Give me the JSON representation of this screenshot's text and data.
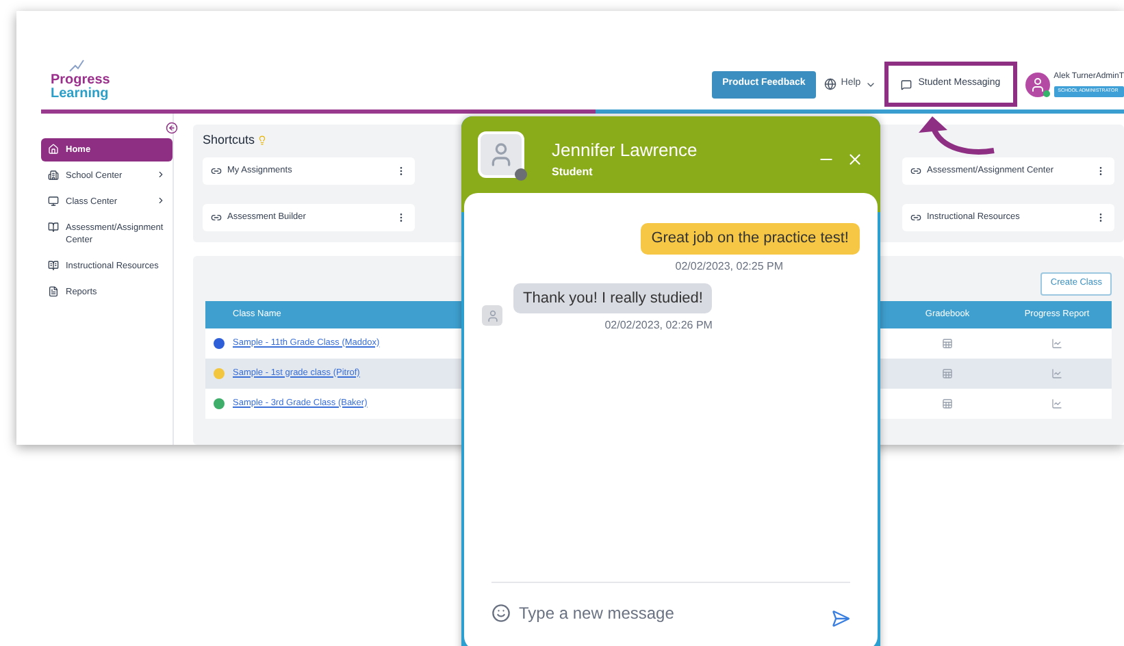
{
  "app": {
    "logo": {
      "line1": "Progress",
      "line2": "Learning"
    },
    "header": {
      "feedback_button": "Product Feedback",
      "help": "Help",
      "messaging": {
        "label": "Student Messaging",
        "highlighted": true
      },
      "user": {
        "name": "Alek TurnerAdminT",
        "role": "SCHOOL ADMINISTRATOR"
      }
    },
    "sidebar": {
      "items": [
        {
          "label": "Home",
          "selected": true,
          "expandable": false
        },
        {
          "label": "School Center",
          "selected": false,
          "expandable": true
        },
        {
          "label": "Class Center",
          "selected": false,
          "expandable": true
        },
        {
          "label": "Assessment/Assignment Center",
          "selected": false,
          "expandable": false
        },
        {
          "label": "Instructional Resources",
          "selected": false,
          "expandable": false
        },
        {
          "label": "Reports",
          "selected": false,
          "expandable": false
        }
      ]
    },
    "shortcuts": {
      "title": "Shortcuts",
      "items": [
        {
          "label": "My Assignments"
        },
        {
          "label": "Assessment/Assignment Center"
        },
        {
          "label": "Assessment Builder"
        },
        {
          "label": "Instructional Resources"
        }
      ]
    },
    "classes": {
      "create_button": "Create Class",
      "columns": [
        "Class Name",
        "Gradebook",
        "Progress Report"
      ],
      "rows": [
        {
          "name": "Sample - 11th Grade Class (Maddox)",
          "color": "#2f5fd8"
        },
        {
          "name": "Sample - 1st grade class (Pitrof)",
          "color": "#f3c640"
        },
        {
          "name": "Sample - 3rd Grade Class (Baker)",
          "color": "#3fae6a"
        }
      ]
    }
  },
  "chat": {
    "name": "Jennifer Lawrence",
    "role": "Student",
    "messages": [
      {
        "kind": "sent",
        "text": "Great job on the practice test!",
        "time": "02/02/2023, 02:25 PM"
      },
      {
        "kind": "received",
        "text": "Thank you! I really studied!",
        "time": "02/02/2023, 02:26 PM"
      }
    ],
    "input": {
      "placeholder": "Type a new message"
    }
  }
}
